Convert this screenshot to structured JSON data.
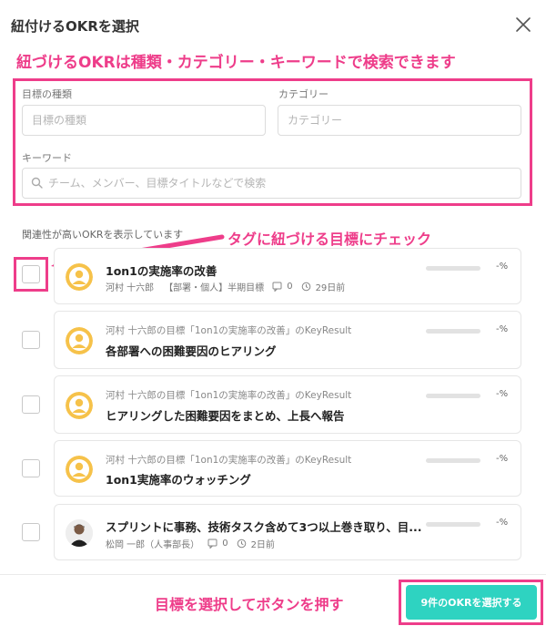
{
  "dialog": {
    "title": "紐付けるOKRを選択",
    "close_icon": "close-icon"
  },
  "annotations": {
    "top": "紐づけるOKRは種類・カテゴリー・キーワードで検索できます",
    "middle": "タグに紐づける目標にチェック",
    "bottom": "目標を選択してボタンを押す",
    "color": "#ee3d8a"
  },
  "filters": {
    "type_label": "目標の種類",
    "type_placeholder": "目標の種類",
    "category_label": "カテゴリー",
    "category_placeholder": "カテゴリー",
    "keyword_label": "キーワード",
    "keyword_placeholder": "チーム、メンバー、目標タイトルなどで検索",
    "search_icon": "search-icon"
  },
  "related_label": "関連性が高いOKRを表示しています",
  "items": [
    {
      "title": "1on1の実施率の改善",
      "owner": "河村 十六郎",
      "tag": "【部署・個人】半期目標",
      "comments": "0",
      "updated": "29日前",
      "progress": 0,
      "pct": "-%",
      "avatar": "user-avatar-yellow"
    },
    {
      "subtitle": "河村 十六郎の目標「1on1の実施率の改善」のKeyResult",
      "title": "各部署への困難要因のヒアリング",
      "progress": 0,
      "pct": "-%",
      "avatar": "user-avatar-yellow"
    },
    {
      "subtitle": "河村 十六郎の目標「1on1の実施率の改善」のKeyResult",
      "title": "ヒアリングした困難要因をまとめ、上長へ報告",
      "progress": 0,
      "pct": "-%",
      "avatar": "user-avatar-yellow"
    },
    {
      "subtitle": "河村 十六郎の目標「1on1の実施率の改善」のKeyResult",
      "title": "1on1実施率のウォッチング",
      "progress": 0,
      "pct": "-%",
      "avatar": "user-avatar-yellow"
    },
    {
      "title": "スプリントに事務、技術タスク含めて3つ以上巻き取り、目...",
      "owner": "松岡 一郎（人事部長）",
      "comments": "0",
      "updated": "2日前",
      "progress": 0,
      "pct": "-%",
      "avatar": "user-avatar-photo"
    }
  ],
  "submit": {
    "label": "9件のOKRを選択する",
    "color": "#2ed3c1"
  }
}
